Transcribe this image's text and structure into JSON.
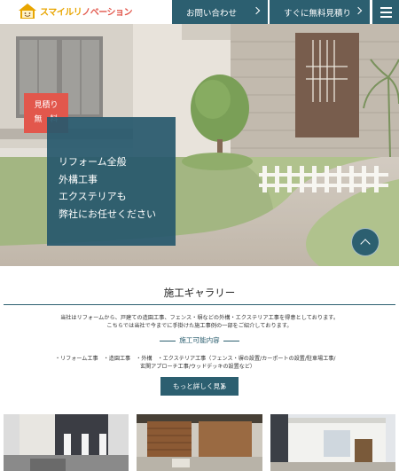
{
  "header": {
    "logo_text_main": "スマイルリ",
    "logo_text_accent": "ノベーション",
    "logo_alt": "スマイルリノベーション",
    "contact_label": "お問い合わせ",
    "estimate_label": "すぐに無料見積り"
  },
  "hero": {
    "badge_line1": "見積り",
    "badge_line2": "無　料",
    "lines": [
      "リフォーム全般",
      "外構工事",
      "エクステリアも",
      "弊社にお任せください"
    ]
  },
  "gallery": {
    "title": "施工ギャラリー",
    "desc1": "当社はリフォームから、戸建ての造園工事、フェンス・塀などの外構・エクステリア工事を得意としております。",
    "desc2": "こちらでは当社で今までに手掛けた施工事例の一部をご紹介しております。",
    "subhead": "施工可能内容",
    "works1": "・リフォーム工事　・造園工事　・外構　・エクステリア工事（フェンス・塀の設置/カーポートの設置/駐車場工事/",
    "works2": "玄関アプローチ工事/ウッドデッキの設置など）",
    "more_label": "もっと詳しく見る"
  },
  "colors": {
    "primary": "#2c5f70",
    "accent": "#e2574c",
    "logo": "#e8a500"
  },
  "icons": {
    "menu": "hamburger-menu-icon",
    "nav_chevron": "chevron-right-icon",
    "scroll_top": "chevron-up-icon"
  }
}
